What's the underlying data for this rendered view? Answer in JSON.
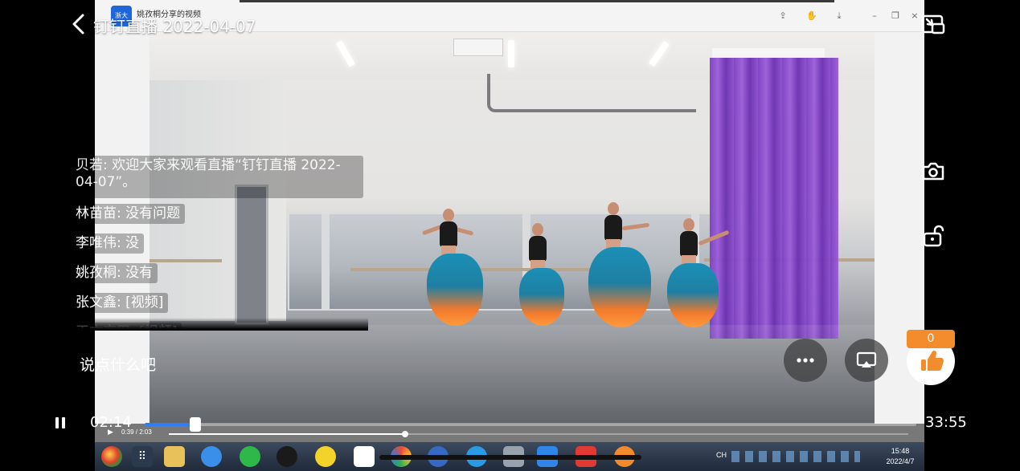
{
  "header": {
    "title": "钉钉直播 2022-04-07"
  },
  "recorded_window": {
    "app_icon_text": "浙大",
    "title": "姚孜桐分享的视频"
  },
  "comments": [
    {
      "author": "贝若",
      "text": "欢迎大家来观看直播“钉钉直播 2022-04-07”。"
    },
    {
      "author": "林苗苗",
      "text": "没有问题"
    },
    {
      "author": "李唯伟",
      "text": "没"
    },
    {
      "author": "姚孜桐",
      "text": "没有"
    },
    {
      "author": "张文鑫",
      "text": "[视频]"
    },
    {
      "author": "王文高田",
      "text": "[视频]"
    }
  ],
  "input": {
    "placeholder": "说点什么吧"
  },
  "like": {
    "count": "0"
  },
  "playback": {
    "current_time": "02:14",
    "total_time": "33:55",
    "progress_fraction": 0.066,
    "accent_color": "#2f7df7"
  },
  "inner_player": {
    "time_text": "0:39 / 2:03",
    "progress_fraction": 0.32
  },
  "taskbar": {
    "ime": "CH",
    "time": "15:48",
    "date": "2022/4/7"
  },
  "icons": {
    "back": "chevron-left-icon",
    "pip": "picture-in-picture-icon",
    "camera": "camera-icon",
    "lock": "unlock-icon",
    "more": "more-dots-icon",
    "cast": "screen-cast-icon",
    "like": "thumbs-up-icon",
    "pause": "pause-icon"
  }
}
